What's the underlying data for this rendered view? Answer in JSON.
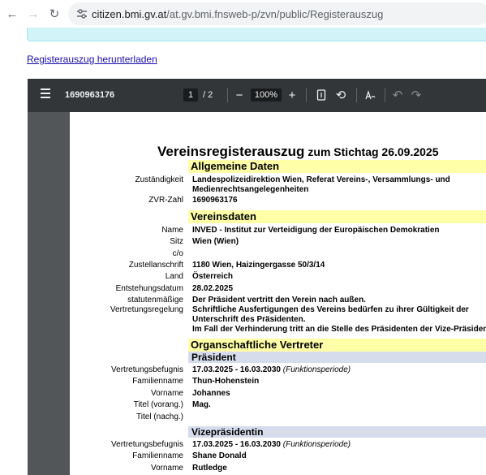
{
  "browser": {
    "url_host": "citizen.bmi.gv.at",
    "url_path": "/at.gv.bmi.fnsweb-p/zvn/public/Registerauszug"
  },
  "page": {
    "download_link": "Registerauszug herunterladen"
  },
  "pdf_toolbar": {
    "filename": "1690963176",
    "current_page": "1",
    "total_pages": "/ 2",
    "zoom": "100%"
  },
  "document": {
    "title": "Vereinsregisterauszug",
    "title_suffix": "zum Stichtag 26.09.2025",
    "allgemein": {
      "heading": "Allgemeine Daten",
      "zustaendigkeit_label": "Zuständigkeit",
      "zustaendigkeit_line1": "Landespolizeidirektion Wien, Referat Vereins-, Versammlungs- und",
      "zustaendigkeit_line2": "Medienrechtsangelegenheiten",
      "zvr_label": "ZVR-Zahl",
      "zvr_value": "1690963176"
    },
    "vereinsdaten": {
      "heading": "Vereinsdaten",
      "name_label": "Name",
      "name_value": "INVED - Institut zur Verteidigung der Europäischen Demokratien",
      "sitz_label": "Sitz",
      "sitz_value": "Wien (Wien)",
      "co_label": "c/o",
      "zustell_label": "Zustellanschrift",
      "zustell_value": "1180 Wien, Haizingergasse 50/3/14",
      "land_label": "Land",
      "land_value": "Österreich",
      "entstehung_label": "Entstehungsdatum",
      "entstehung_value": "28.02.2025",
      "statut_label1": "statutenmäßige",
      "statut_label2": "Vertretungsregelung",
      "statut_line1": "Der Präsident vertritt den Verein nach außen.",
      "statut_line2": "Schriftliche Ausfertigungen des Vereins bedürfen zu ihrer Gültigkeit der",
      "statut_line3": "Unterschrift des Präsidenten.",
      "statut_line4": "Im Fall der Verhinderung tritt an die Stelle des Präsidenten der Vize-Präsident."
    },
    "organ": {
      "heading": "Organschaftliche Vertreter",
      "praesident": {
        "heading": "Präsident",
        "befugnis_label": "Vertretungsbefugnis",
        "befugnis_value": "17.03.2025 - 16.03.2030",
        "befugnis_period": "(Funktionsperiode)",
        "familienname_label": "Familienname",
        "familienname_value": "Thun-Hohenstein",
        "vorname_label": "Vorname",
        "vorname_value": "Johannes",
        "titel_vorang_label": "Titel (vorang.)",
        "titel_vorang_value": "Mag.",
        "titel_nachg_label": "Titel (nachg.)"
      },
      "vize": {
        "heading": "Vizepräsidentin",
        "befugnis_label": "Vertretungsbefugnis",
        "befugnis_value": "17.03.2025 - 16.03.2030",
        "befugnis_period": "(Funktionsperiode)",
        "familienname_label": "Familienname",
        "familienname_value": "Shane Donald",
        "vorname_label": "Vorname",
        "vorname_value": "Rutledge"
      }
    }
  }
}
